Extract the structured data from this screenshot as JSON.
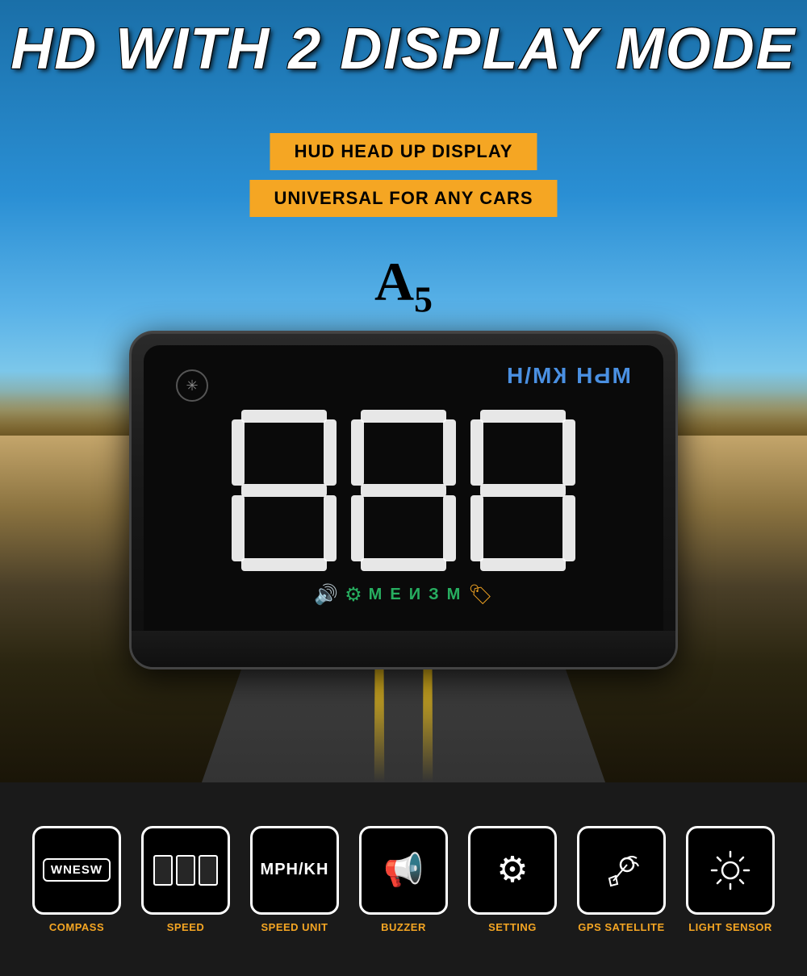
{
  "header": {
    "title": "HD WITH 2 DISPLAY MODE",
    "badge1": "HUD HEAD UP DISPLAY",
    "badge2": "UNIVERSAL FOR ANY CARS",
    "model": "A",
    "model_sub": "5"
  },
  "hud": {
    "unit_label": "МЬН КМ\\Н",
    "digits": "888",
    "status_icons": "МЕ И З М"
  },
  "features": [
    {
      "id": "compass",
      "label": "COMPASS",
      "display": "WNESW"
    },
    {
      "id": "speed",
      "label": "SPEED",
      "display": "digits"
    },
    {
      "id": "speed-unit",
      "label": "SPEED UNIT",
      "display": "MPH/KH"
    },
    {
      "id": "buzzer",
      "label": "BUZZER",
      "display": "speaker"
    },
    {
      "id": "setting",
      "label": "SETTING",
      "display": "gear"
    },
    {
      "id": "gps-satellite",
      "label": "GPS SATELLITE",
      "display": "gps"
    },
    {
      "id": "light-sensor",
      "label": "LIGHT SENSOR",
      "display": "sun"
    }
  ]
}
